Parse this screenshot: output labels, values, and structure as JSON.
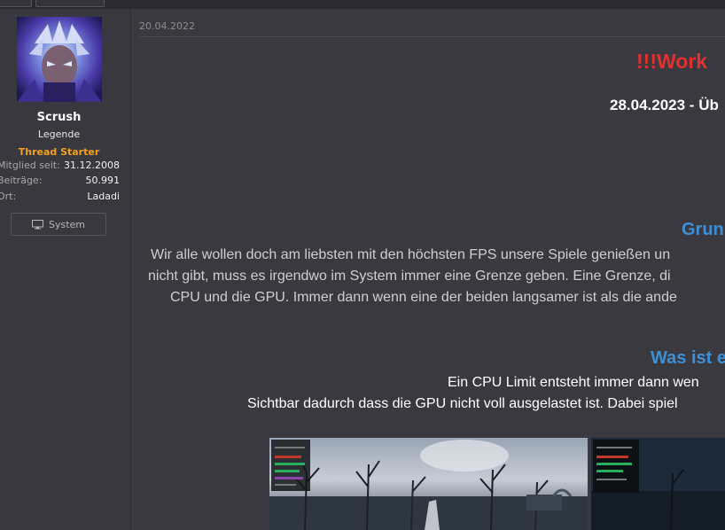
{
  "user": {
    "name": "Scrush",
    "title": "Legende",
    "badge": "Thread Starter",
    "stats": [
      {
        "label": "Mitglied seit:",
        "value": "31.12.2008"
      },
      {
        "label": "Beiträge:",
        "value": "50.991"
      },
      {
        "label": "Ort:",
        "value": "Ladadi"
      }
    ],
    "system_button": "System"
  },
  "post": {
    "date": "20.04.2022",
    "wip": "!!!Work",
    "update_line": "28.04.2023 - Üb",
    "heading_1": "Grun",
    "para_1": [
      "Wir alle wollen doch am liebsten mit den höchsten FPS unsere Spiele genießen un",
      "nicht gibt, muss es irgendwo im System immer eine Grenze geben. Eine Grenze, di",
      "CPU und die GPU. Immer dann wenn eine der beiden langsamer ist als die ande"
    ],
    "heading_2": "Was ist e",
    "para_2": [
      "Ein CPU Limit entsteht immer dann wen",
      "Sichtbar dadurch dass die GPU nicht voll ausgelastet ist. Dabei spiel"
    ]
  },
  "colors": {
    "accent_red": "#e03030",
    "accent_blue": "#3f8fd6",
    "badge_orange": "#f0a020",
    "background": "#3a393f"
  },
  "icons": {
    "system_button": "monitor-icon"
  }
}
